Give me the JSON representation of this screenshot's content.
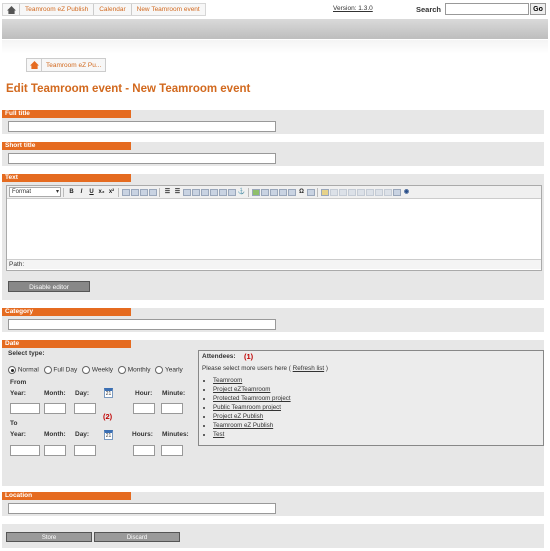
{
  "breadcrumbs": [
    "Teamroom eZ Publish",
    "Calendar",
    "New Teamroom event"
  ],
  "version_link": "Version: 1.3.0",
  "search": {
    "label": "Search",
    "value": "",
    "go_label": "Go"
  },
  "tab_label": "Teamroom eZ Pu...",
  "page_title": "Edit Teamroom event - New Teamroom event",
  "sections": {
    "full_title": "Full title",
    "short_title": "Short title",
    "text": "Text",
    "category": "Category",
    "date": "Date",
    "location": "Location"
  },
  "editor": {
    "format_label": "Format",
    "path_label": "Path:",
    "disable_label": "Disable editor",
    "icons": [
      "bold-icon",
      "italic-icon",
      "underline-icon",
      "subscript-icon",
      "superscript-icon",
      "align-left-icon",
      "align-center-icon",
      "align-right-icon",
      "justify-icon",
      "bullet-list-icon",
      "numbered-list-icon",
      "outdent-icon",
      "indent-icon",
      "undo-icon",
      "redo-icon",
      "link-icon",
      "unlink-icon",
      "anchor-icon",
      "image-icon",
      "media-icon",
      "table-icon",
      "special-char-icon",
      "help-icon"
    ]
  },
  "date": {
    "select_type": "Select type:",
    "types": [
      "Normal",
      "Full Day",
      "Weekly",
      "Monthly",
      "Yearly"
    ],
    "selected_type": "Normal",
    "from": "From",
    "to": "To",
    "year": "Year:",
    "month": "Month:",
    "day": "Day:",
    "hour_from": "Hour:",
    "hours_to": "Hours:",
    "minute": "Minute:",
    "minutes": "Minutes:",
    "marker_2": "(2)",
    "cal_day": "21"
  },
  "attendees": {
    "title": "Attendees:",
    "marker_1": "(1)",
    "prompt": "Please select more users here (",
    "refresh": "Refresh list",
    "prompt_end": ")",
    "items": [
      "Teamroom",
      "Project eZTeamroom",
      "Protected Teamroom project",
      "Public Teamroom project",
      "Project eZ Publish",
      "Teamroom eZ Publish",
      "Test"
    ]
  },
  "buttons": {
    "store": "Store",
    "discard": "Discard"
  },
  "colors": {
    "accent": "#e56b20",
    "title": "#d2691e",
    "section_bg": "#e7e7e7"
  }
}
